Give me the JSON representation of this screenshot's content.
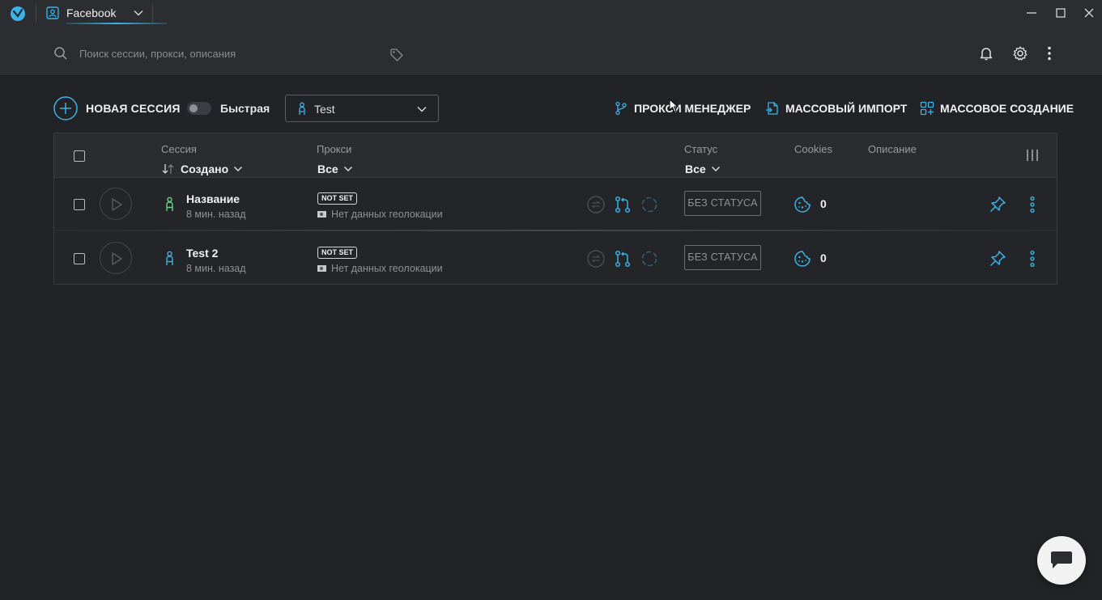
{
  "titlebar": {
    "profile_name": "Facebook"
  },
  "search": {
    "placeholder": "Поиск сессии, прокси, описания"
  },
  "toolbar": {
    "new_session_label": "НОВАЯ СЕССИЯ",
    "quick_label": "Быстрая",
    "quick_enabled": false,
    "folder_selected": "Test",
    "proxy_manager_label": "ПРОКСИ МЕНЕДЖЕР",
    "mass_import_label": "МАССОВЫЙ ИМПОРТ",
    "mass_create_label": "МАССОВОЕ СОЗДАНИЕ"
  },
  "table": {
    "columns": {
      "session": "Сессия",
      "session_sort": "Создано",
      "proxy": "Прокси",
      "proxy_filter": "Все",
      "status": "Статус",
      "status_filter": "Все",
      "cookies": "Cookies",
      "description": "Описание"
    },
    "rows": [
      {
        "name": "Название",
        "created": "8 мин. назад",
        "proxy_badge": "NOT SET",
        "geo": "Нет данных геолокации",
        "status": "БЕЗ СТАТУСА",
        "cookies": "0",
        "avatar_color": "#6fd08a"
      },
      {
        "name": "Test 2",
        "created": "8 мин. назад",
        "proxy_badge": "NOT SET",
        "geo": "Нет данных геолокации",
        "status": "БЕЗ СТАТУСА",
        "cookies": "0",
        "avatar_color": "#3bb3e6"
      }
    ]
  },
  "colors": {
    "accent": "#3bb3e6",
    "background": "#222327",
    "panel": "#2b2d31"
  }
}
